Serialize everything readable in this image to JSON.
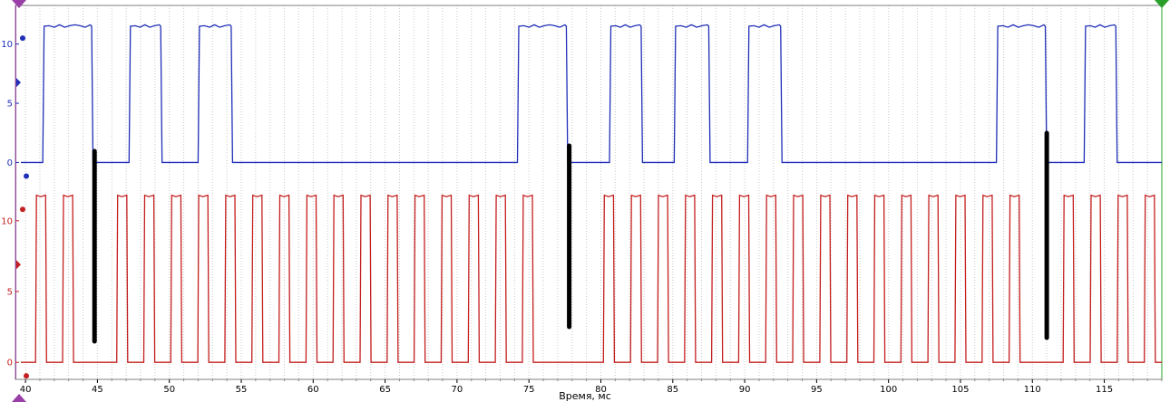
{
  "chart_data": {
    "type": "line",
    "title": "",
    "xlabel": "Время, мс",
    "x_ticks": [
      40,
      45,
      50,
      55,
      60,
      65,
      70,
      75,
      80,
      85,
      90,
      95,
      100,
      105,
      110,
      115
    ],
    "xlim": [
      39.3,
      119.0
    ],
    "grid": true,
    "legend": "none",
    "channels": [
      {
        "color": "#1f2fb8",
        "ylim": [
          -0.5,
          12.8
        ],
        "y_ticks": [
          0,
          5,
          10
        ],
        "high": 11.5,
        "low": 0,
        "edges": [
          [
            41.2,
            44.6
          ],
          [
            47.2,
            49.4
          ],
          [
            52.0,
            54.3
          ],
          [
            74.2,
            77.6
          ],
          [
            80.6,
            82.8
          ],
          [
            85.1,
            87.5
          ],
          [
            90.2,
            92.5
          ],
          [
            107.5,
            110.9
          ],
          [
            113.6,
            115.8
          ]
        ]
      },
      {
        "color": "#c41e1e",
        "ylim": [
          -0.5,
          12.8
        ],
        "y_ticks": [
          0,
          5,
          10
        ],
        "high": 11.8,
        "low": 0,
        "first_pulse": [
          40.7,
          41.4
        ],
        "period": 1.88,
        "end": 118.6,
        "gap_at_ms": [
          44.8,
          77.8,
          111.0
        ]
      }
    ],
    "markers": [
      {
        "x": 44.8,
        "from_channel": "blue_zero",
        "to_channel": "red_low"
      },
      {
        "x": 77.8,
        "from_channel": "blue_zero",
        "to_channel": "red_low"
      },
      {
        "x": 111.0,
        "from_channel": "blue_zero",
        "to_channel": "red_low"
      }
    ]
  }
}
